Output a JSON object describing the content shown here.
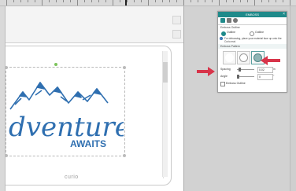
{
  "canvas": {
    "brand_mark": "curio",
    "design_text": "dventure",
    "design_sub": "AWAITS"
  },
  "panel": {
    "title": "EMBOSS",
    "close_icon": "close-icon",
    "tabs": [
      {
        "icon": "emboss-tab-icon",
        "color": "#1f8a8a"
      },
      {
        "icon": "fill-tab-icon",
        "color": "#555555"
      },
      {
        "icon": "pattern-tab-icon",
        "color": "#555555"
      }
    ],
    "emboss_section_label": "Emboss Outline",
    "radio_options": [
      {
        "label": "Outline",
        "selected": true
      },
      {
        "label": "Outline",
        "selected": false
      }
    ],
    "info_text": "For debossing, place your material face up onto the Curio mat.",
    "shape_section_label": "Emboss Pattern",
    "shape_options": [
      {
        "name": "none-shape",
        "color": "#ffffff"
      },
      {
        "name": "outline-shape",
        "color": "#dcdcdc"
      },
      {
        "name": "filled-shape",
        "color": "#8fb5b5"
      }
    ],
    "fields": [
      {
        "label": "Spacing",
        "value": "0.02",
        "unit": "in"
      },
      {
        "label": "Angle",
        "value": "0",
        "unit": "°"
      }
    ],
    "checkbox_label": "Emboss Outline"
  },
  "annotations": {
    "arrow_color": "#d8344a"
  }
}
